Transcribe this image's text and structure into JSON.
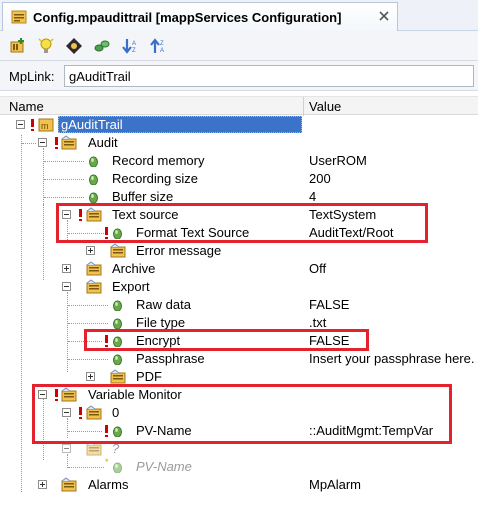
{
  "tab": {
    "title": "Config.mpaudittrail [mappServices Configuration]",
    "icon": "config-file-icon",
    "close_icon": "close-icon"
  },
  "toolbar": {
    "buttons": [
      "add-element-icon",
      "light-bulb-icon",
      "navigate-icon",
      "link-icon",
      "sort-descending-icon",
      "sort-ascending-icon"
    ]
  },
  "mplink": {
    "label": "MpLink:",
    "value": "gAuditTrail"
  },
  "grid": {
    "col_name": "Name",
    "col_value": "Value"
  },
  "tree": {
    "root": "gAuditTrail",
    "audit": "Audit",
    "record_memory": {
      "name": "Record memory",
      "value": "UserROM"
    },
    "recording_size": {
      "name": "Recording size",
      "value": "200"
    },
    "buffer_size": {
      "name": "Buffer size",
      "value": "4"
    },
    "text_source": {
      "name": "Text source",
      "value": "TextSystem"
    },
    "format_text_source": {
      "name": "Format Text Source",
      "value": "AuditText/Root"
    },
    "error_message": {
      "name": "Error message",
      "value": ""
    },
    "archive": {
      "name": "Archive",
      "value": "Off"
    },
    "export": {
      "name": "Export",
      "value": ""
    },
    "raw_data": {
      "name": "Raw data",
      "value": "FALSE"
    },
    "file_type": {
      "name": "File type",
      "value": ".txt"
    },
    "encrypt": {
      "name": "Encrypt",
      "value": "FALSE"
    },
    "passphrase": {
      "name": "Passphrase",
      "value": "Insert your passphrase here."
    },
    "pdf": {
      "name": "PDF",
      "value": ""
    },
    "variable_monitor": {
      "name": "Variable Monitor",
      "value": ""
    },
    "vm_index0": {
      "name": "0",
      "value": ""
    },
    "pv_name": {
      "name": "PV-Name",
      "value": "::AuditMgmt:TempVar"
    },
    "vm_index_new": {
      "name": "?",
      "value": ""
    },
    "pv_name_placeholder": {
      "name": "PV-Name",
      "value": ""
    },
    "alarms": {
      "name": "Alarms",
      "value": "MpAlarm"
    }
  },
  "colors": {
    "highlight_box": "#e3222e",
    "selection": "#3b73c9",
    "leaf_icon": "#6aa84f",
    "error_marker": "#d00000"
  }
}
